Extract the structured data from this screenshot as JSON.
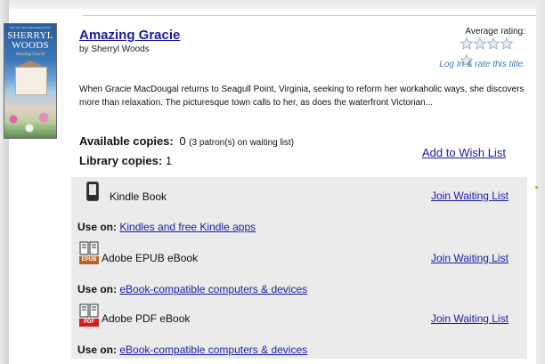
{
  "book": {
    "title": "Amazing Gracie",
    "byline": "by Sherryl Woods",
    "cover": {
      "author_text": "SHERRYL WOODS",
      "title_text": "Amazing Gracie",
      "tagline": "New York Times Bestselling Author"
    },
    "description": "When Gracie MacDougal returns to Seagull Point, Virginia, seeking to reform her workaholic ways, she discovers more than relaxation. The picturesque town calls to her, as does the waterfront Victorian..."
  },
  "rating": {
    "label": "Average rating:",
    "stars_filled": 0,
    "stars_total": 5,
    "rate_link": "Log In & rate this title."
  },
  "availability": {
    "available_label": "Available copies:",
    "available_value": "0",
    "waiting_note": "(3 patron(s) on waiting list)",
    "library_label": "Library copies:",
    "library_value": "1",
    "wish_link": "Add to Wish List"
  },
  "formats": [
    {
      "name": "Kindle Book",
      "icon": "kindle-icon",
      "join_label": "Join Waiting List",
      "use_on_label": "Use on:",
      "use_on_link": "Kindles and free Kindle apps"
    },
    {
      "name": "Adobe EPUB eBook",
      "icon": "epub-icon",
      "badge": "EPUB",
      "join_label": "Join Waiting List",
      "use_on_label": "Use on:",
      "use_on_link": "eBook-compatible computers & devices"
    },
    {
      "name": "Adobe PDF eBook",
      "icon": "pdf-icon",
      "badge": "PDF",
      "join_label": "Join Waiting List",
      "use_on_label": "Use on:",
      "use_on_link": "eBook-compatible computers & devices"
    }
  ],
  "colors": {
    "link": "#1a1aa6",
    "rate_link": "#4a78b8",
    "panel_bg": "#ebebeb",
    "epub_badge": "#b5632a",
    "pdf_badge": "#d41e1e"
  }
}
